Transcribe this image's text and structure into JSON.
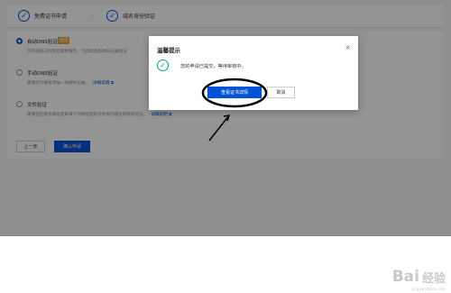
{
  "steps": [
    {
      "label": "免费证书申请",
      "icon": "✓"
    },
    {
      "label": "域名身份验证",
      "icon": "✓"
    }
  ],
  "step_separator": "›",
  "options": [
    {
      "title": "自动DNS验证",
      "badge": "推荐",
      "desc": "您的域名已托管云解析服务，可自动添加DNS记录验证",
      "selected": true,
      "link": ""
    },
    {
      "title": "手动DNS验证",
      "badge": "",
      "desc": "需要您为域名添加一条解析记录。",
      "selected": false,
      "link": "详细说明 ⧉"
    },
    {
      "title": "文件验证",
      "badge": "",
      "desc": "需要您在服务器指定目录下创建指定的文件进行域名所有权验证。",
      "selected": false,
      "link": "详细说明 ⧉"
    }
  ],
  "buttons": {
    "prev": "上一步",
    "confirm": "确认申请"
  },
  "dialog": {
    "title": "温馨提示",
    "close": "×",
    "message": "您的申请已提交，等待审核中。",
    "primary": "查看证书详情",
    "cancel": "取消",
    "success_icon": "✓"
  },
  "watermark": {
    "logo": "Bai",
    "text": "经验",
    "sub": "jingyan.baidu.com"
  },
  "colors": {
    "primary": "#0052d9",
    "success": "#00a870",
    "badge": "#e8a33d"
  }
}
